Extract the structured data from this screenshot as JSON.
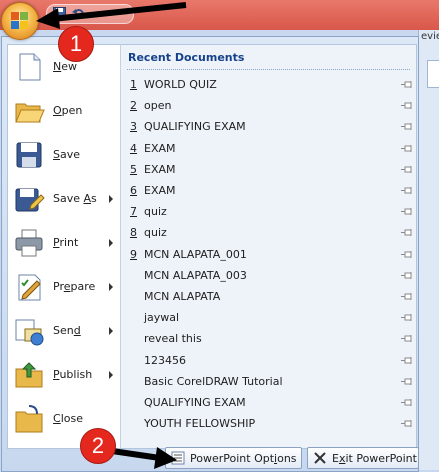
{
  "title_bar": {
    "partial_tab_text": "evie"
  },
  "office_button": {
    "icon": "office-logo-icon"
  },
  "left_menu": {
    "items": [
      {
        "label": "New",
        "underline": "N",
        "rest": "ew",
        "icon": "new-document-icon",
        "has_submenu": false
      },
      {
        "label": "Open",
        "underline": "O",
        "rest": "pen",
        "icon": "open-folder-icon",
        "has_submenu": false
      },
      {
        "label": "Save",
        "underline": "S",
        "rest": "ave",
        "icon": "save-disk-icon",
        "has_submenu": false
      },
      {
        "label": "Save As",
        "prefix": "Save ",
        "underline": "A",
        "rest": "s",
        "icon": "save-as-icon",
        "has_submenu": true
      },
      {
        "label": "Print",
        "underline": "P",
        "rest": "rint",
        "icon": "printer-icon",
        "has_submenu": true
      },
      {
        "label": "Prepare",
        "prefix": "Pr",
        "underline": "e",
        "rest": "pare",
        "icon": "prepare-icon",
        "has_submenu": true
      },
      {
        "label": "Send",
        "prefix": "Sen",
        "underline": "d",
        "rest": "",
        "icon": "send-icon",
        "has_submenu": true
      },
      {
        "label": "Publish",
        "underline": "P",
        "rest": "ublish",
        "icon": "publish-icon",
        "has_submenu": true
      },
      {
        "label": "Close",
        "underline": "C",
        "rest": "lose",
        "icon": "close-folder-icon",
        "has_submenu": false
      }
    ]
  },
  "recent_documents": {
    "header": "Recent Documents",
    "items": [
      {
        "num": "1",
        "name": "WORLD QUIZ"
      },
      {
        "num": "2",
        "name": "open"
      },
      {
        "num": "3",
        "name": "QUALIFYING EXAM"
      },
      {
        "num": "4",
        "name": "EXAM"
      },
      {
        "num": "5",
        "name": "EXAM"
      },
      {
        "num": "6",
        "name": "EXAM"
      },
      {
        "num": "7",
        "name": "quiz"
      },
      {
        "num": "8",
        "name": "quiz"
      },
      {
        "num": "9",
        "name": "MCN ALAPATA_001"
      },
      {
        "num": "",
        "name": "MCN ALAPATA_003"
      },
      {
        "num": "",
        "name": "MCN ALAPATA"
      },
      {
        "num": "",
        "name": "jaywal"
      },
      {
        "num": "",
        "name": "reveal this"
      },
      {
        "num": "",
        "name": "123456"
      },
      {
        "num": "",
        "name": "Basic CorelDRAW Tutorial"
      },
      {
        "num": "",
        "name": "QUALIFYING EXAM"
      },
      {
        "num": "",
        "name": "YOUTH FELLOWSHIP"
      }
    ]
  },
  "bottom_buttons": {
    "options": {
      "prefix": "PowerPoint Opt",
      "underline": "i",
      "rest": "ons",
      "icon": "options-icon"
    },
    "exit": {
      "prefix": "E",
      "underline": "x",
      "rest": "it PowerPoint",
      "icon": "exit-x-icon"
    }
  },
  "annotations": {
    "badge_1": "1",
    "badge_2": "2",
    "badge_color": "#e4281e",
    "arrow_color": "#000000"
  },
  "colors": {
    "title_bar": "#d9574a",
    "menu_header": "#15428b"
  }
}
